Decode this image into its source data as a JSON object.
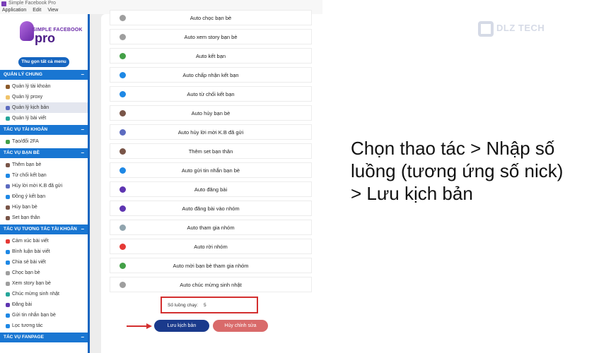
{
  "window": {
    "title": "Simple Facebook Pro",
    "menu": [
      "Application",
      "Edit",
      "View"
    ]
  },
  "logo": {
    "top": "SIMPLE FACEBOOK",
    "big": "pro"
  },
  "sidebar": {
    "collapse_label": "Thu gọn tất cả menu",
    "sections": [
      {
        "title": "QUẢN LÝ CHUNG",
        "items": [
          {
            "label": "Quản lý tài khoản",
            "color": "#8b5a2b"
          },
          {
            "label": "Quản lý proxy",
            "color": "#f0c36a"
          },
          {
            "label": "Quản lý kịch bản",
            "color": "#5c6bc0",
            "active": true
          },
          {
            "label": "Quản lý bài viết",
            "color": "#26a69a"
          }
        ]
      },
      {
        "title": "TÁC VỤ TÀI KHOẢN",
        "items": [
          {
            "label": "Tạo/đổi 2FA",
            "color": "#43a047"
          }
        ]
      },
      {
        "title": "TÁC VỤ BẠN BÈ",
        "items": [
          {
            "label": "Thêm bạn bè",
            "color": "#795548"
          },
          {
            "label": "Từ chối kết bạn",
            "color": "#1e88e5"
          },
          {
            "label": "Hủy lời mời K.B đã gửi",
            "color": "#5c6bc0"
          },
          {
            "label": "Đồng ý kết bạn",
            "color": "#1e88e5"
          },
          {
            "label": "Hủy bạn bè",
            "color": "#795548"
          },
          {
            "label": "Set bạn thân",
            "color": "#795548"
          }
        ]
      },
      {
        "title": "TÁC VỤ TƯƠNG TÁC TÀI KHOẢN",
        "items": [
          {
            "label": "Cảm xúc bài viết",
            "color": "#e53935"
          },
          {
            "label": "Bình luận bài viết",
            "color": "#1e88e5"
          },
          {
            "label": "Chia sẻ bài viết",
            "color": "#1e88e5"
          },
          {
            "label": "Chọc bạn bè",
            "color": "#9e9e9e"
          },
          {
            "label": "Xem story bạn bè",
            "color": "#9e9e9e"
          },
          {
            "label": "Chúc mừng sinh nhật",
            "color": "#26a69a"
          },
          {
            "label": "Đăng bài",
            "color": "#5e35b1"
          },
          {
            "label": "Gửi tin nhắn bạn bè",
            "color": "#1e88e5"
          },
          {
            "label": "Lọc tương tác",
            "color": "#1e88e5"
          }
        ]
      },
      {
        "title": "TÁC VỤ FANPAGE",
        "items": []
      }
    ]
  },
  "actions": [
    {
      "label": "Auto chọc bạn bè",
      "color": "#9e9e9e"
    },
    {
      "label": "Auto xem story bạn bè",
      "color": "#9e9e9e"
    },
    {
      "label": "Auto kết bạn",
      "color": "#43a047"
    },
    {
      "label": "Auto chấp nhận kết bạn",
      "color": "#1e88e5"
    },
    {
      "label": "Auto từ chối kết bạn",
      "color": "#1e88e5"
    },
    {
      "label": "Auto hủy bạn bè",
      "color": "#795548"
    },
    {
      "label": "Auto hủy lời mời K.B đã gửi",
      "color": "#5c6bc0"
    },
    {
      "label": "Thêm set bạn thân",
      "color": "#795548"
    },
    {
      "label": "Auto gửi tin nhắn bạn bè",
      "color": "#1e88e5"
    },
    {
      "label": "Auto đăng bài",
      "color": "#5e35b1"
    },
    {
      "label": "Auto đăng bài vào nhóm",
      "color": "#5e35b1"
    },
    {
      "label": "Auto tham gia nhóm",
      "color": "#90a4ae"
    },
    {
      "label": "Auto rời nhóm",
      "color": "#e53935"
    },
    {
      "label": "Auto mời bạn bè tham gia nhóm",
      "color": "#43a047"
    },
    {
      "label": "Auto chúc mừng sinh nhật",
      "color": "#9e9e9e"
    }
  ],
  "threads": {
    "label": "Số luồng chạy:",
    "value": "5"
  },
  "buttons": {
    "save": "Lưu kịch bản",
    "cancel": "Hủy chỉnh sửa"
  },
  "watermark": {
    "text": "DLZ TECH"
  },
  "caption": "Chọn thao tác > Nhập số luồng (tương ứng số nick) > Lưu kịch bản"
}
